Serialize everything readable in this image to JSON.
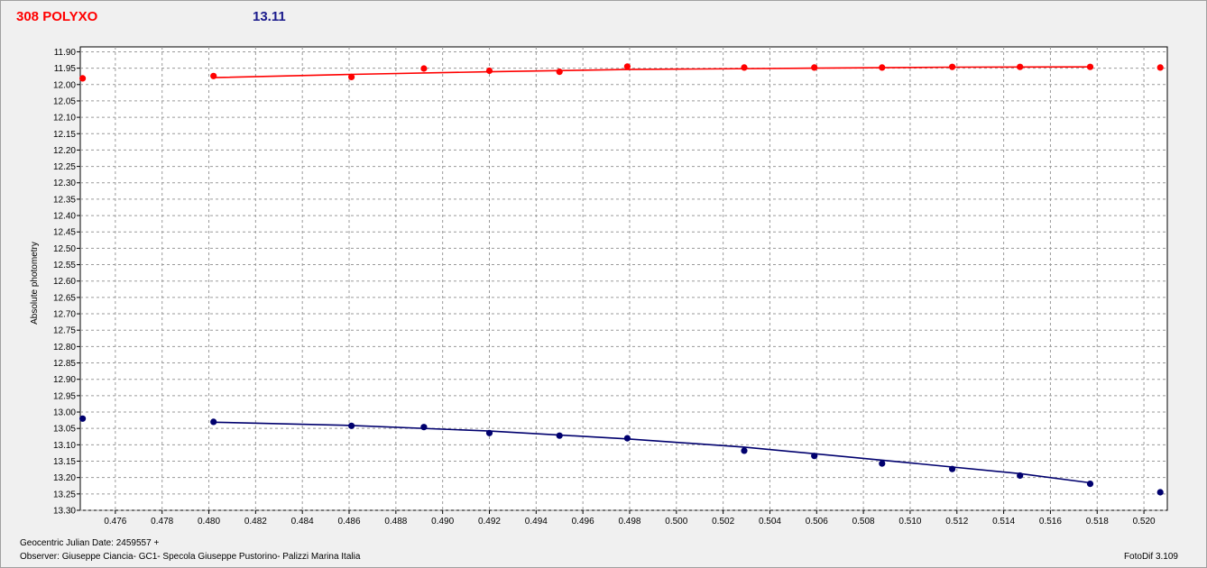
{
  "header": {
    "object_name": "308 POLYXO",
    "value": "13.11"
  },
  "footer": {
    "date_label": "Geocentric Julian Date:",
    "date_value": "2459557 +",
    "observer_label": "Observer:",
    "observer_value": "Giuseppe Ciancia- GC1- Specola Giuseppe Pustorino- Palizzi Marina Italia",
    "software": "FotoDif 3.109"
  },
  "chart_data": {
    "type": "scatter",
    "ylabel": "Absolute photometry",
    "xlim": [
      0.4745,
      0.521
    ],
    "ylim": [
      13.3,
      11.885
    ],
    "y_inverted": true,
    "grid": true,
    "x_ticks": [
      "0.476",
      "0.478",
      "0.480",
      "0.482",
      "0.484",
      "0.486",
      "0.488",
      "0.490",
      "0.492",
      "0.494",
      "0.496",
      "0.498",
      "0.500",
      "0.502",
      "0.504",
      "0.506",
      "0.508",
      "0.510",
      "0.512",
      "0.514",
      "0.516",
      "0.518",
      "0.520"
    ],
    "y_ticks": [
      "11.90",
      "11.95",
      "12.00",
      "12.05",
      "12.10",
      "12.15",
      "12.20",
      "12.25",
      "12.30",
      "12.35",
      "12.40",
      "12.45",
      "12.50",
      "12.55",
      "12.60",
      "12.65",
      "12.70",
      "12.75",
      "12.80",
      "12.85",
      "12.90",
      "12.95",
      "13.00",
      "13.05",
      "13.10",
      "13.15",
      "13.20",
      "13.25",
      "13.30"
    ],
    "series": [
      {
        "color": "#ff0000",
        "points": [
          [
            0.4746,
            11.981
          ],
          [
            0.4802,
            11.974
          ],
          [
            0.4861,
            11.977
          ],
          [
            0.4892,
            11.951
          ],
          [
            0.492,
            11.958
          ],
          [
            0.495,
            11.961
          ],
          [
            0.4979,
            11.945
          ],
          [
            0.5029,
            11.948
          ],
          [
            0.5059,
            11.948
          ],
          [
            0.5088,
            11.948
          ],
          [
            0.5118,
            11.946
          ],
          [
            0.5147,
            11.946
          ],
          [
            0.5177,
            11.946
          ],
          [
            0.5207,
            11.948
          ]
        ],
        "fit": [
          [
            0.4802,
            11.979
          ],
          [
            0.4861,
            11.969
          ],
          [
            0.492,
            11.961
          ],
          [
            0.4979,
            11.954
          ],
          [
            0.5059,
            11.95
          ],
          [
            0.5118,
            11.947
          ],
          [
            0.5177,
            11.946
          ]
        ]
      },
      {
        "color": "#00006e",
        "points": [
          [
            0.4746,
            13.02
          ],
          [
            0.4802,
            13.03
          ],
          [
            0.4861,
            13.042
          ],
          [
            0.4892,
            13.046
          ],
          [
            0.492,
            13.064
          ],
          [
            0.495,
            13.072
          ],
          [
            0.4979,
            13.08
          ],
          [
            0.5029,
            13.118
          ],
          [
            0.5059,
            13.134
          ],
          [
            0.5088,
            13.157
          ],
          [
            0.5118,
            13.174
          ],
          [
            0.5147,
            13.194
          ],
          [
            0.5177,
            13.219
          ],
          [
            0.5207,
            13.245
          ]
        ],
        "fit": [
          [
            0.4802,
            13.031
          ],
          [
            0.4861,
            13.041
          ],
          [
            0.492,
            13.058
          ],
          [
            0.4979,
            13.082
          ],
          [
            0.5029,
            13.107
          ],
          [
            0.5088,
            13.147
          ],
          [
            0.5147,
            13.188
          ],
          [
            0.5177,
            13.216
          ]
        ]
      }
    ]
  }
}
